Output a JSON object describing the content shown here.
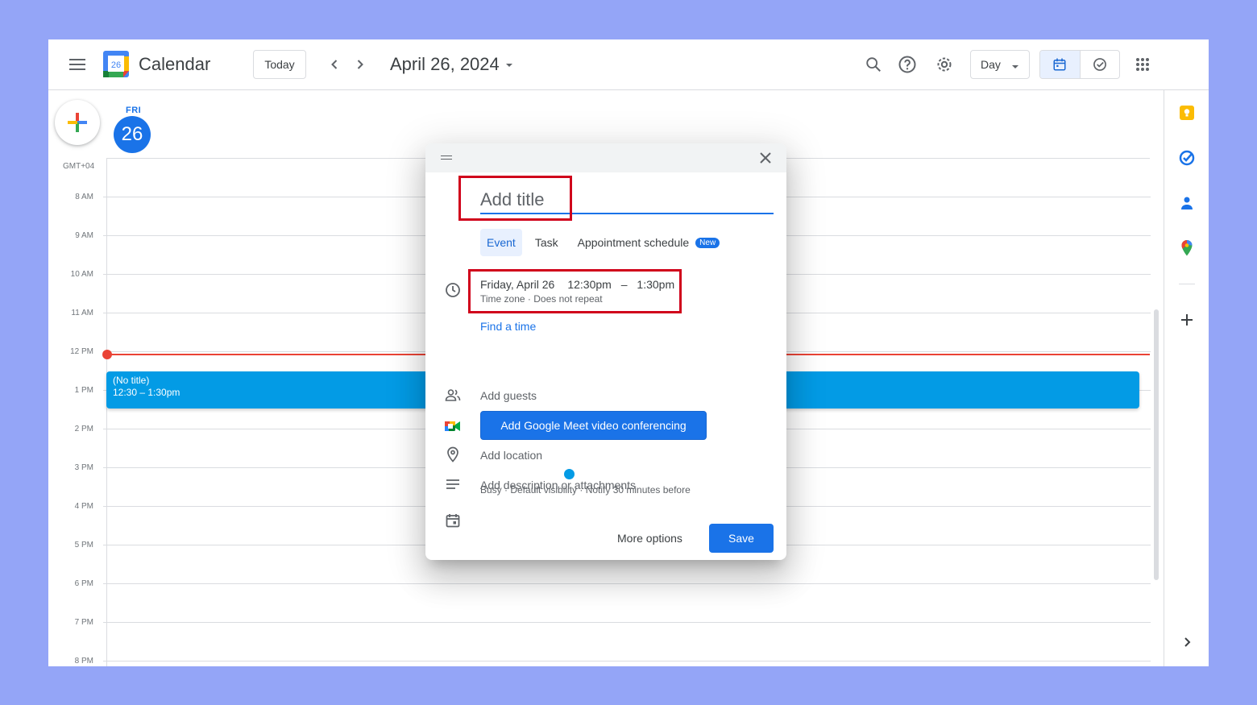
{
  "header": {
    "app_title": "Calendar",
    "logo_day": "26",
    "today_label": "Today",
    "current_date": "April 26, 2024",
    "view_label": "Day",
    "icons": [
      "menu-icon",
      "prev-icon",
      "next-icon",
      "search-icon",
      "help-icon",
      "settings-icon",
      "calendar-view-icon",
      "tasks-view-icon",
      "apps-grid-icon"
    ]
  },
  "day": {
    "name": "FRI",
    "number": "26",
    "timezone": "GMT+04"
  },
  "hours": [
    "8 AM",
    "9 AM",
    "10 AM",
    "11 AM",
    "12 PM",
    "1 PM",
    "2 PM",
    "3 PM",
    "4 PM",
    "5 PM",
    "6 PM",
    "7 PM",
    "8 PM"
  ],
  "event": {
    "title": "(No title)",
    "time": "12:30 – 1:30pm"
  },
  "dialog": {
    "title_placeholder": "Add title",
    "tabs": {
      "event": "Event",
      "task": "Task",
      "appointment": "Appointment schedule",
      "new_badge": "New"
    },
    "date": "Friday, April 26",
    "start_time": "12:30pm",
    "dash": "–",
    "end_time": "1:30pm",
    "date_sub": "Time zone · Does not repeat",
    "find_time": "Find a time",
    "add_guests": "Add guests",
    "meet_button": "Add Google Meet video conferencing",
    "add_location": "Add location",
    "add_description": "Add description or attachments",
    "status_line": "Busy · Default visibility · Notify 30 minutes before",
    "more_options": "More options",
    "save": "Save"
  },
  "colors": {
    "accent": "#1a73e8",
    "event": "#039be5",
    "now_line": "#ea4335",
    "highlight": "#d0021b",
    "page_background": "#94a5f7"
  }
}
